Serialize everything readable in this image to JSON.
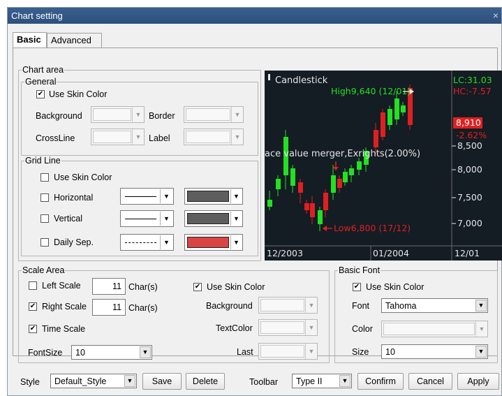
{
  "window": {
    "title": "Chart setting",
    "close_glyph": "×"
  },
  "tabs": [
    {
      "label": "Basic"
    },
    {
      "label": "Advanced"
    }
  ],
  "chart_area": {
    "label": "Chart area",
    "general": {
      "label": "General",
      "use_skin_color": {
        "label": "Use Skin Color",
        "checked": true
      },
      "background_label": "Background",
      "border_label": "Border",
      "crossline_label": "CrossLine",
      "label_label": "Label"
    },
    "grid_line": {
      "label": "Grid Line",
      "use_skin_color": {
        "label": "Use Skin Color",
        "checked": false
      },
      "rows": [
        {
          "label": "Horizontal",
          "checked": false,
          "line_style": "solid",
          "color": "#5e5e5e"
        },
        {
          "label": "Vertical",
          "checked": false,
          "line_style": "solid",
          "color": "#5e5e5e"
        },
        {
          "label": "Daily Sep.",
          "checked": false,
          "line_style": "dashed",
          "color": "#d94444"
        }
      ]
    }
  },
  "preview": {
    "title": "Candlestick",
    "high_label": "High9,640 (12/01)",
    "low_label": "Low6,800 (17/12)",
    "event_label": "ace value merger,Exrights(2.00%)",
    "lc_label": "LC:31.03",
    "hc_label": "HC:-7.57",
    "price_badge": "8,910",
    "change_badge": "-2.62%",
    "y_ticks": [
      "8,500",
      "8,000",
      "7,500",
      "7,000"
    ],
    "x_ticks": [
      "12/2003",
      "01/2004",
      "12/01"
    ],
    "colors": {
      "up": "#22e022",
      "down": "#e02020",
      "bg": "#141c24"
    }
  },
  "scale_area": {
    "label": "Scale Area",
    "left_scale": {
      "label": "Left Scale",
      "checked": false,
      "value": "11",
      "unit": "Char(s)"
    },
    "right_scale": {
      "label": "Right Scale",
      "checked": true,
      "value": "11",
      "unit": "Char(s)"
    },
    "time_scale": {
      "label": "Time Scale",
      "checked": true
    },
    "fontsize_label": "FontSize",
    "fontsize_value": "10",
    "use_skin_color": {
      "label": "Use Skin Color",
      "checked": true
    },
    "background_label": "Background",
    "textcolor_label": "TextColor",
    "last_label": "Last"
  },
  "basic_font": {
    "label": "Basic Font",
    "use_skin_color": {
      "label": "Use Skin Color",
      "checked": true
    },
    "font_label": "Font",
    "font_value": "Tahoma",
    "color_label": "Color",
    "size_label": "Size",
    "size_value": "10"
  },
  "footer": {
    "style_label": "Style",
    "style_value": "Default_Style",
    "save": "Save",
    "delete": "Delete",
    "toolbar_label": "Toolbar",
    "toolbar_value": "Type II",
    "confirm": "Confirm",
    "cancel": "Cancel",
    "apply": "Apply"
  }
}
